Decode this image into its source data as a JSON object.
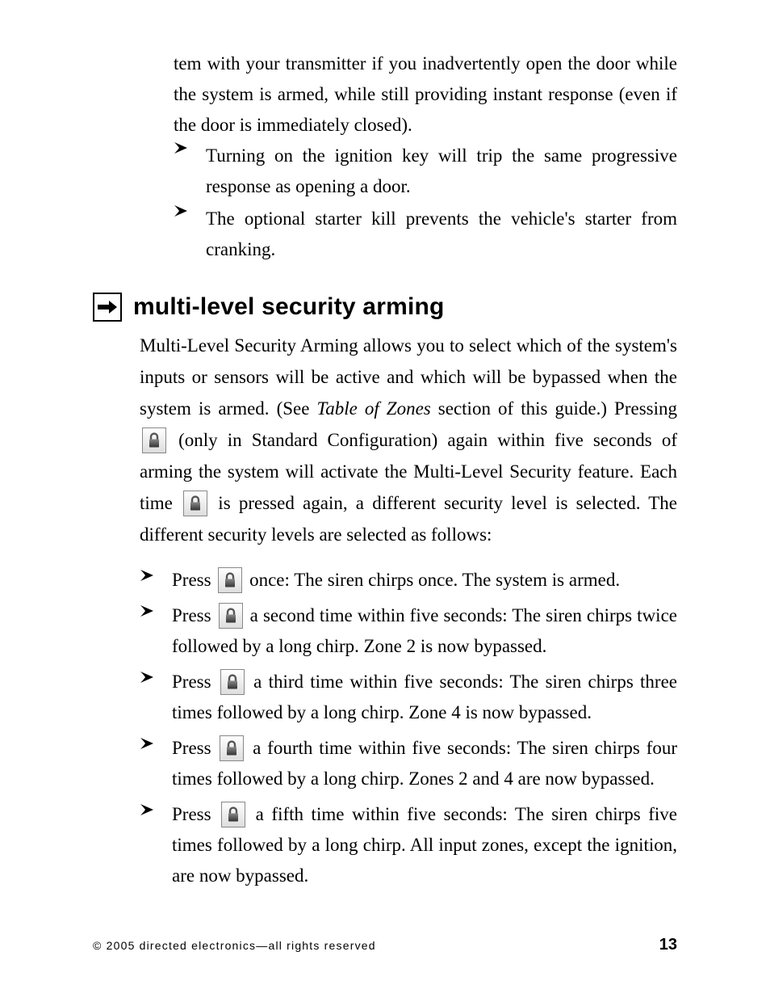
{
  "continuation": {
    "par1_tail": "tem with your transmitter if you inadvertently open the door while the system is armed, while still providing instant response (even if the door is immediately closed).",
    "bullets": [
      "Turning on the ignition key will trip the same progressive response as opening a door.",
      "The optional starter kill prevents the vehicle's starter from cranking."
    ]
  },
  "section": {
    "title": "multi-level security arming",
    "para_part1": "Multi-Level Security Arming allows you to select which of the system's inputs or sensors will be active and which will be bypassed when the system is armed. (See ",
    "para_italic": "Table of Zones",
    "para_part2": " section of this guide.) Pressing ",
    "para_part3": " (only in Standard Configuration) again within five seconds of arming the system will activate the Multi-Level Security feature. Each time ",
    "para_part4": " is pressed again, a different security level is selected. The different security levels are selected as follows:",
    "steps": [
      {
        "pre": "Press ",
        "post": " once: The siren chirps once. The system is armed."
      },
      {
        "pre": "Press ",
        "post": " a second time within five seconds: The siren chirps twice followed by a long chirp. Zone 2 is now bypassed."
      },
      {
        "pre": "Press ",
        "post": " a third time within five seconds: The siren chirps three times followed by a long chirp. Zone 4 is now bypassed."
      },
      {
        "pre": "Press ",
        "post": " a fourth time within five seconds: The siren chirps four times followed by a long chirp. Zones 2 and 4 are now bypassed."
      },
      {
        "pre": "Press ",
        "post": " a fifth time within five seconds: The siren chirps five times followed by a long chirp. All input zones, except the ignition, are now bypassed."
      }
    ]
  },
  "footer": {
    "copyright": "© 2005 directed electronics—all rights reserved",
    "page_number": "13"
  },
  "icons": {
    "bullet": "arrowhead-right-icon",
    "section_arrow": "arrow-right-box-icon",
    "lock": "lock-button-icon"
  }
}
